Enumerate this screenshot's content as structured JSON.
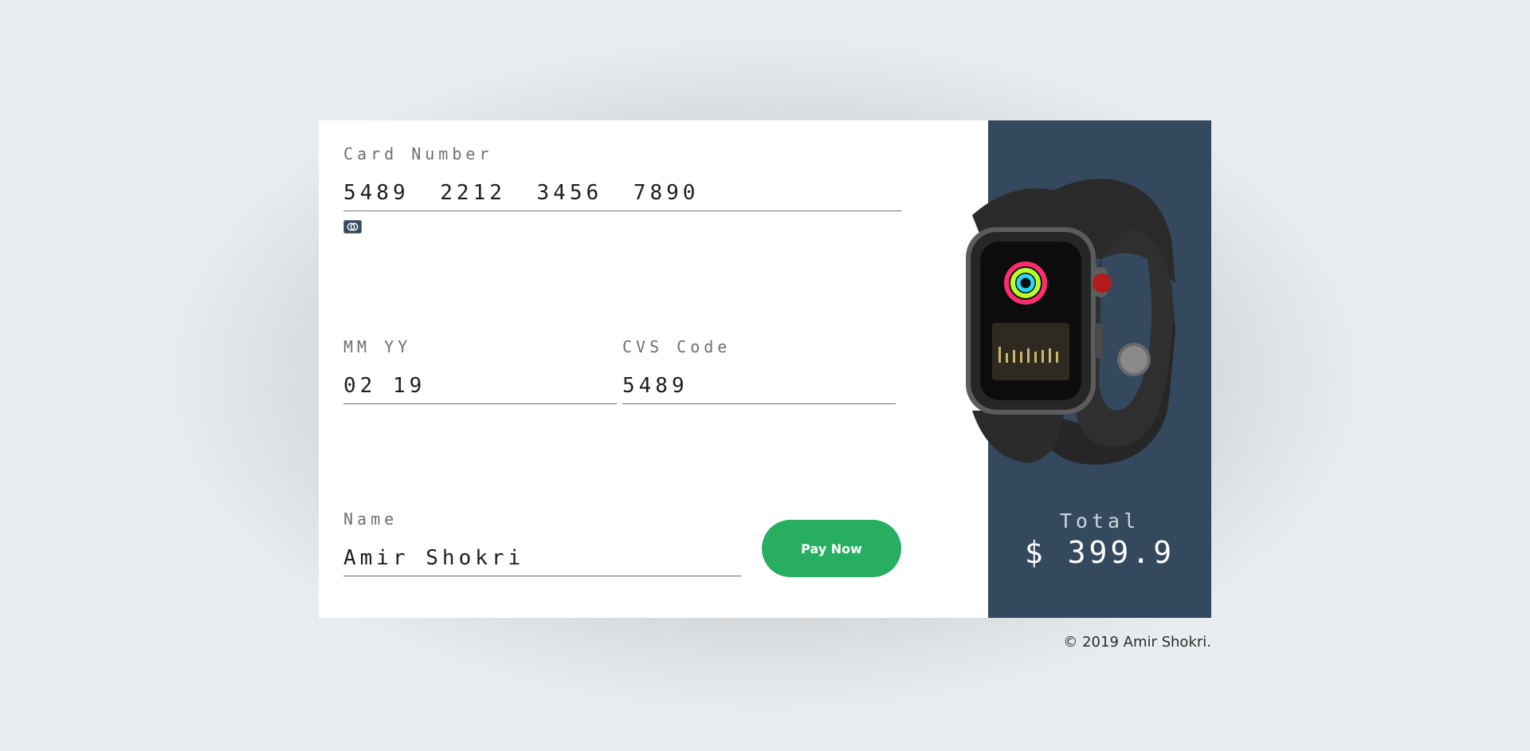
{
  "card_number": {
    "label": "Card Number",
    "value": "5489 2212 3456 7890"
  },
  "expiry": {
    "label": "MM YY",
    "value": "02 19"
  },
  "cvs": {
    "label": "CVS Code",
    "value": "5489"
  },
  "name": {
    "label": "Name",
    "value": "Amir Shokri"
  },
  "pay_button": "Pay Now",
  "total": {
    "label": "Total",
    "value": "$ 399.9"
  },
  "footer": "© 2019 Amir Shokri.",
  "colors": {
    "sidebar": "#34495e",
    "button": "#27ae60",
    "background": "#e9edef"
  },
  "icons": [
    "card-brand-icon",
    "smartwatch-image"
  ]
}
